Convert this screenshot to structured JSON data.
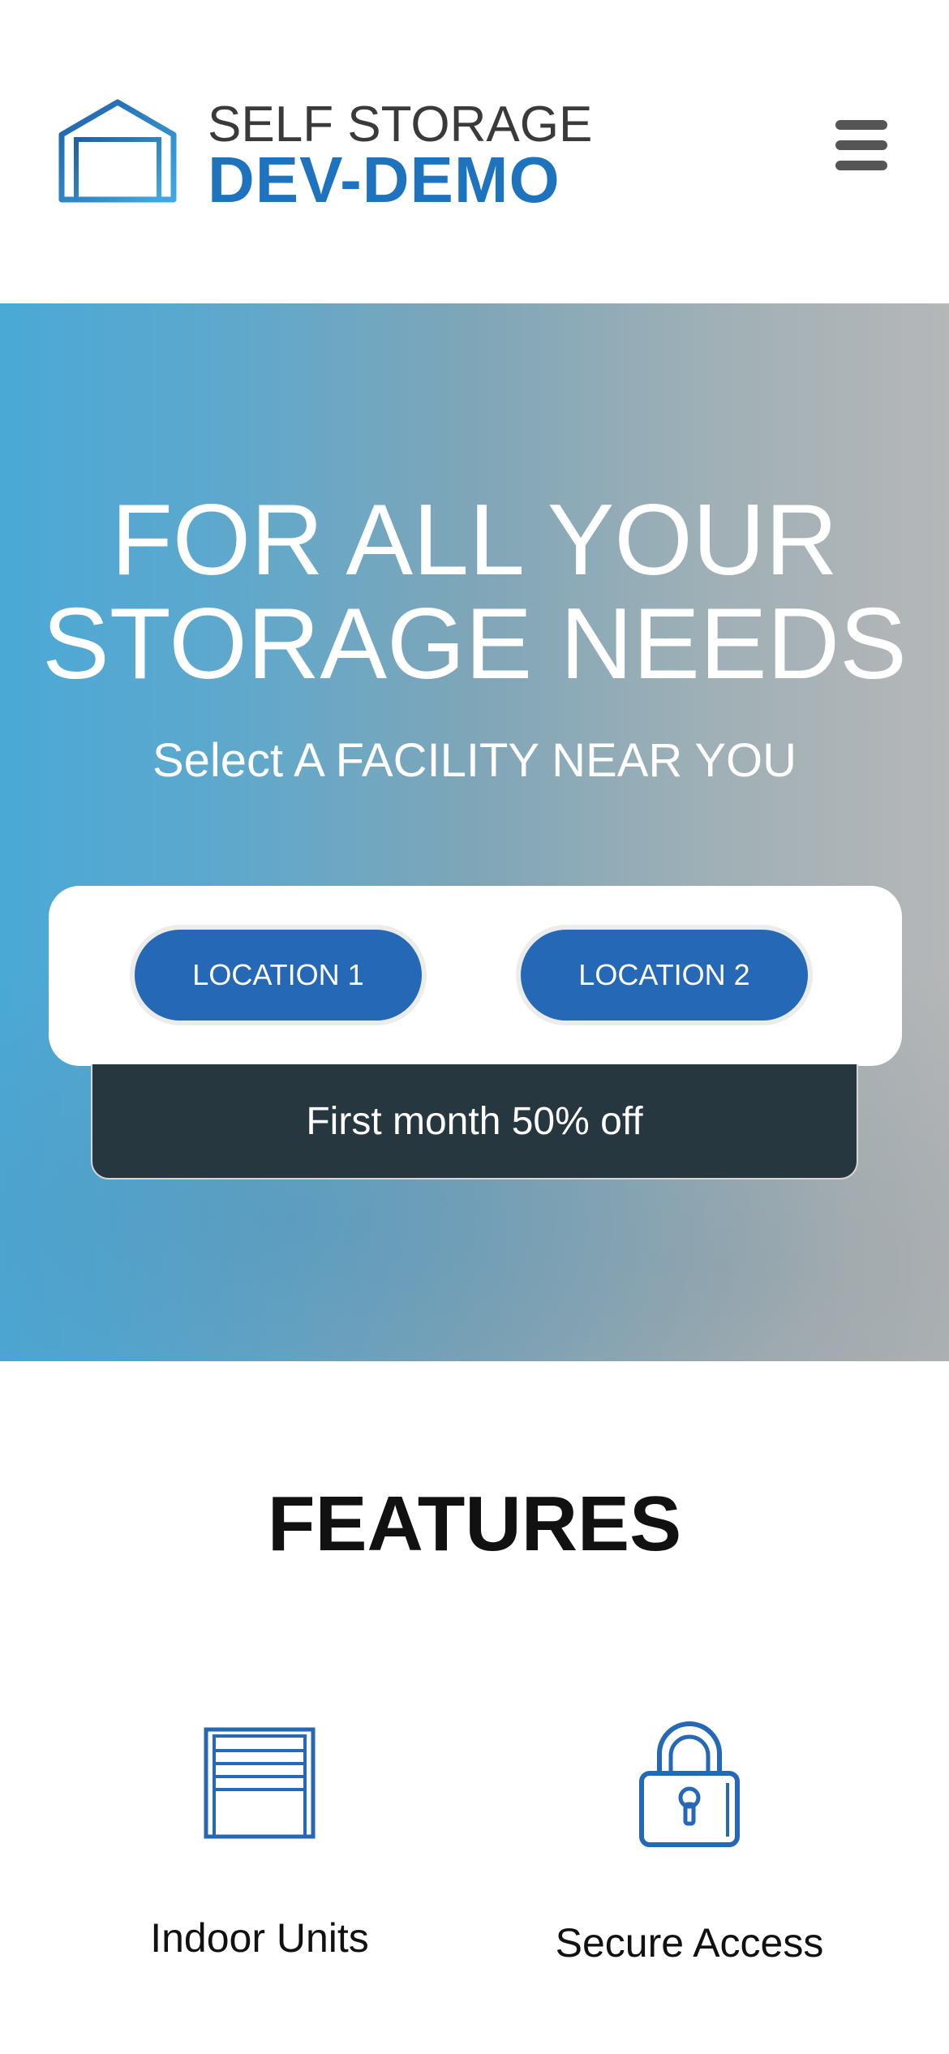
{
  "header": {
    "logo_line1": "SELF STORAGE",
    "logo_line2": "DEV-DEMO",
    "menu_icon": "hamburger-menu-icon",
    "logo_icon": "garage-door-icon"
  },
  "hero": {
    "title": "FOR ALL YOUR STORAGE NEEDS",
    "subtitle": "Select A FACILITY NEAR YOU",
    "locations": [
      {
        "label": "LOCATION 1"
      },
      {
        "label": "LOCATION 2"
      }
    ],
    "promo": "First month 50% off"
  },
  "features": {
    "title": "FEATURES",
    "items": [
      {
        "label": "Indoor Units",
        "icon": "garage-door-icon"
      },
      {
        "label": "Secure Access",
        "icon": "padlock-icon"
      }
    ]
  },
  "colors": {
    "brand_blue": "#1e73be",
    "button_blue": "#2468b6",
    "promo_dark": "#263740"
  }
}
